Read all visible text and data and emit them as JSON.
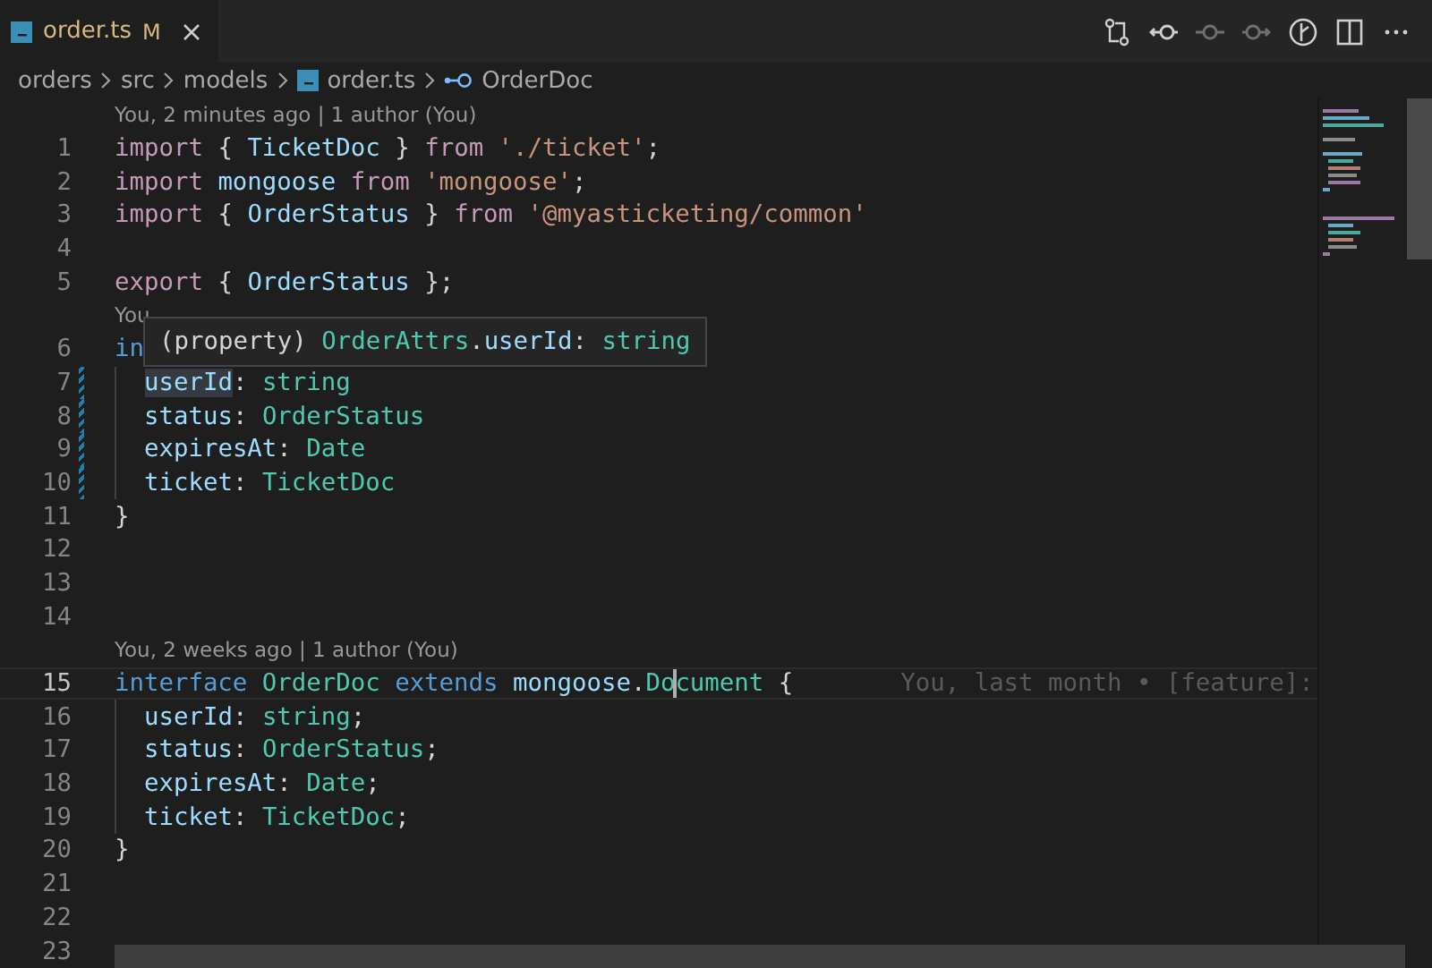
{
  "tabs": [
    {
      "label": "order.ts",
      "status": "M",
      "selected": true,
      "modified": true
    }
  ],
  "toolbar": [
    {
      "kind": "compare",
      "disabled": false
    },
    {
      "kind": "back",
      "disabled": false
    },
    {
      "kind": "commit",
      "disabled": true
    },
    {
      "kind": "forward",
      "disabled": true
    },
    {
      "kind": "graph",
      "disabled": false
    },
    {
      "kind": "split",
      "disabled": false
    },
    {
      "kind": "more",
      "disabled": false
    }
  ],
  "breadcrumbs": [
    {
      "kind": "folder",
      "label": "orders"
    },
    {
      "kind": "folder",
      "label": "src"
    },
    {
      "kind": "folder",
      "label": "models"
    },
    {
      "kind": "file",
      "label": "order.ts"
    },
    {
      "kind": "symbol",
      "label": "OrderDoc"
    }
  ],
  "lines": [
    {
      "kind": "codelens",
      "text": "You, 2 minutes ago | 1 author (You)"
    },
    {
      "kind": "code",
      "number": "1",
      "current": false,
      "modified": false,
      "guide": false,
      "tokens": [
        {
          "kind": "control",
          "text": "import"
        },
        {
          "kind": "punct",
          "text": " { "
        },
        {
          "kind": "variable",
          "text": "TicketDoc"
        },
        {
          "kind": "punct",
          "text": " } "
        },
        {
          "kind": "control",
          "text": "from "
        },
        {
          "kind": "string",
          "text": "'./ticket'"
        },
        {
          "kind": "punct",
          "text": ";"
        }
      ]
    },
    {
      "kind": "code",
      "number": "2",
      "current": false,
      "modified": false,
      "guide": false,
      "tokens": [
        {
          "kind": "control",
          "text": "import "
        },
        {
          "kind": "variable",
          "text": "mongoose "
        },
        {
          "kind": "control",
          "text": "from "
        },
        {
          "kind": "string",
          "text": "'mongoose'"
        },
        {
          "kind": "punct",
          "text": ";"
        }
      ]
    },
    {
      "kind": "code",
      "number": "3",
      "current": false,
      "modified": false,
      "guide": false,
      "tokens": [
        {
          "kind": "control",
          "text": "import"
        },
        {
          "kind": "punct",
          "text": " { "
        },
        {
          "kind": "variable",
          "text": "OrderStatus"
        },
        {
          "kind": "punct",
          "text": " } "
        },
        {
          "kind": "control",
          "text": "from "
        },
        {
          "kind": "string",
          "text": "'@myasticketing/common'"
        }
      ]
    },
    {
      "kind": "code",
      "number": "4",
      "current": false,
      "modified": false,
      "guide": false
    },
    {
      "kind": "code",
      "number": "5",
      "current": false,
      "modified": false,
      "guide": false,
      "tokens": [
        {
          "kind": "control",
          "text": "export"
        },
        {
          "kind": "punct",
          "text": " { "
        },
        {
          "kind": "variable",
          "text": "OrderStatus"
        },
        {
          "kind": "punct",
          "text": " };"
        }
      ]
    },
    {
      "kind": "codelens",
      "text": "You"
    },
    {
      "kind": "code",
      "number": "6",
      "current": false,
      "modified": false,
      "guide": false,
      "tokens": [
        {
          "kind": "keyword",
          "text": "in"
        }
      ]
    },
    {
      "kind": "code",
      "number": "7",
      "current": false,
      "modified": true,
      "guide": true,
      "tokens": [
        {
          "kind": "variable",
          "text": "userId",
          "highlighted": true
        },
        {
          "kind": "punct",
          "text": ": "
        },
        {
          "kind": "type",
          "text": "string"
        }
      ]
    },
    {
      "kind": "code",
      "number": "8",
      "current": false,
      "modified": true,
      "guide": true,
      "tokens": [
        {
          "kind": "variable",
          "text": "status"
        },
        {
          "kind": "punct",
          "text": ": "
        },
        {
          "kind": "type",
          "text": "OrderStatus"
        }
      ]
    },
    {
      "kind": "code",
      "number": "9",
      "current": false,
      "modified": true,
      "guide": true,
      "tokens": [
        {
          "kind": "variable",
          "text": "expiresAt"
        },
        {
          "kind": "punct",
          "text": ": "
        },
        {
          "kind": "type",
          "text": "Date"
        }
      ]
    },
    {
      "kind": "code",
      "number": "10",
      "current": false,
      "modified": true,
      "guide": true,
      "tokens": [
        {
          "kind": "variable",
          "text": "ticket"
        },
        {
          "kind": "punct",
          "text": ": "
        },
        {
          "kind": "type",
          "text": "TicketDoc"
        }
      ]
    },
    {
      "kind": "code",
      "number": "11",
      "current": false,
      "modified": false,
      "guide": false,
      "tokens": [
        {
          "kind": "punct",
          "text": "}"
        }
      ]
    },
    {
      "kind": "code",
      "number": "12",
      "current": false,
      "modified": false,
      "guide": false
    },
    {
      "kind": "code",
      "number": "13",
      "current": false,
      "modified": false,
      "guide": false
    },
    {
      "kind": "code",
      "number": "14",
      "current": false,
      "modified": false,
      "guide": false
    },
    {
      "kind": "codelens",
      "text": "You, 2 weeks ago | 1 author (You)"
    },
    {
      "kind": "code",
      "number": "15",
      "current": true,
      "modified": false,
      "guide": false,
      "blame": "You, last month • [feature]:",
      "tokens": [
        {
          "kind": "keyword",
          "text": "interface "
        },
        {
          "kind": "type",
          "text": "OrderDoc "
        },
        {
          "kind": "keyword",
          "text": "extends "
        },
        {
          "kind": "variable",
          "text": "mongoose"
        },
        {
          "kind": "punct",
          "text": "."
        },
        {
          "kind": "type",
          "text": "Do"
        },
        {
          "kind": "caret"
        },
        {
          "kind": "type",
          "text": "cument"
        },
        {
          "kind": "punct",
          "text": " {"
        }
      ]
    },
    {
      "kind": "code",
      "number": "16",
      "current": false,
      "modified": false,
      "guide": true,
      "tokens": [
        {
          "kind": "variable",
          "text": "userId"
        },
        {
          "kind": "punct",
          "text": ": "
        },
        {
          "kind": "type",
          "text": "string"
        },
        {
          "kind": "punct",
          "text": ";"
        }
      ]
    },
    {
      "kind": "code",
      "number": "17",
      "current": false,
      "modified": false,
      "guide": true,
      "tokens": [
        {
          "kind": "variable",
          "text": "status"
        },
        {
          "kind": "punct",
          "text": ": "
        },
        {
          "kind": "type",
          "text": "OrderStatus"
        },
        {
          "kind": "punct",
          "text": ";"
        }
      ]
    },
    {
      "kind": "code",
      "number": "18",
      "current": false,
      "modified": false,
      "guide": true,
      "tokens": [
        {
          "kind": "variable",
          "text": "expiresAt"
        },
        {
          "kind": "punct",
          "text": ": "
        },
        {
          "kind": "type",
          "text": "Date"
        },
        {
          "kind": "punct",
          "text": ";"
        }
      ]
    },
    {
      "kind": "code",
      "number": "19",
      "current": false,
      "modified": false,
      "guide": true,
      "tokens": [
        {
          "kind": "variable",
          "text": "ticket"
        },
        {
          "kind": "punct",
          "text": ": "
        },
        {
          "kind": "type",
          "text": "TicketDoc"
        },
        {
          "kind": "punct",
          "text": ";"
        }
      ]
    },
    {
      "kind": "code",
      "number": "20",
      "current": false,
      "modified": false,
      "guide": false,
      "tokens": [
        {
          "kind": "punct",
          "text": "}"
        }
      ]
    },
    {
      "kind": "code",
      "number": "21",
      "current": false,
      "modified": false,
      "guide": false
    },
    {
      "kind": "code",
      "number": "22",
      "current": false,
      "modified": false,
      "guide": false
    },
    {
      "kind": "code",
      "number": "23",
      "current": false,
      "modified": false,
      "guide": false
    }
  ],
  "hover": {
    "tokens": [
      {
        "kind": "punct",
        "text": "(property) "
      },
      {
        "kind": "type",
        "text": "OrderAttrs"
      },
      {
        "kind": "punct",
        "text": "."
      },
      {
        "kind": "variable",
        "text": "userId"
      },
      {
        "kind": "punct",
        "text": ": "
      },
      {
        "kind": "type",
        "text": "string"
      }
    ]
  }
}
